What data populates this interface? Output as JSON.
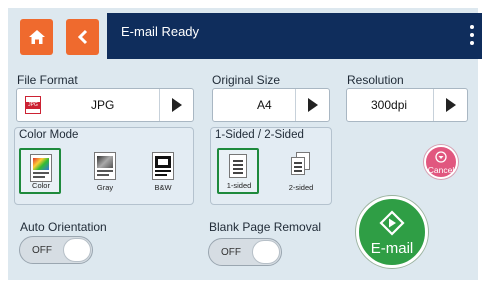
{
  "header": {
    "status": "E-mail Ready"
  },
  "file_format": {
    "label": "File Format",
    "badge": "JPG",
    "value": "JPG"
  },
  "original_size": {
    "label": "Original Size",
    "value": "A4"
  },
  "resolution": {
    "label": "Resolution",
    "value": "300dpi"
  },
  "color_mode": {
    "label": "Color Mode",
    "options": [
      {
        "label": "Color",
        "selected": true
      },
      {
        "label": "Gray",
        "selected": false
      },
      {
        "label": "B&W",
        "selected": false
      }
    ]
  },
  "sides": {
    "label": "1-Sided / 2-Sided",
    "options": [
      {
        "label": "1-sided",
        "selected": true
      },
      {
        "label": "2-sided",
        "selected": false
      }
    ]
  },
  "auto_orientation": {
    "label": "Auto Orientation",
    "state": "OFF"
  },
  "blank_page_removal": {
    "label": "Blank Page Removal",
    "state": "OFF"
  },
  "actions": {
    "email": "E-mail",
    "cancel": "Cancel"
  },
  "colors": {
    "accent": "#ef6a2e",
    "status_bar": "#0f2d5c",
    "selected": "#1e8a3c",
    "email": "#2f9e45",
    "cancel": "#e1577f"
  }
}
